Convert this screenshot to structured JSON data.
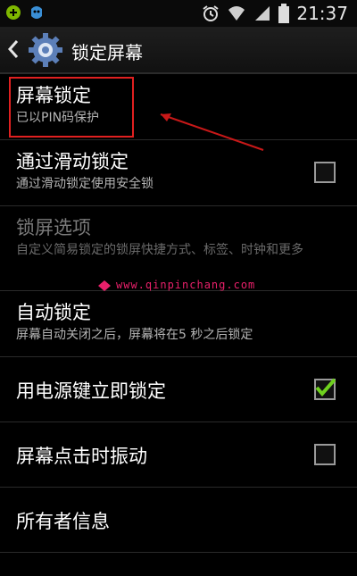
{
  "status_bar": {
    "time": "21:37",
    "icons": [
      "notification-icon",
      "usb-icon",
      "alarm-icon",
      "wifi-icon",
      "signal-icon",
      "battery-icon"
    ]
  },
  "action_bar": {
    "title": "锁定屏幕"
  },
  "settings": [
    {
      "title": "屏幕锁定",
      "subtitle": "已以PIN码保护",
      "enabled": true
    },
    {
      "title": "通过滑动锁定",
      "subtitle": "通过滑动锁定使用安全锁",
      "checked": false,
      "enabled": true
    },
    {
      "title": "锁屏选项",
      "subtitle": "自定义简易锁定的锁屏快捷方式、标签、时钟和更多",
      "enabled": false
    },
    {
      "title": "自动锁定",
      "subtitle": "屏幕自动关闭之后，屏幕将在5 秒之后锁定",
      "enabled": true
    },
    {
      "title": "用电源键立即锁定",
      "checked": true,
      "enabled": true
    },
    {
      "title": "屏幕点击时振动",
      "checked": false,
      "enabled": true
    },
    {
      "title": "所有者信息",
      "enabled": true
    }
  ],
  "watermark": "www.qinpinchang.com",
  "colors": {
    "highlight": "#e02020",
    "checkmark": "#6fd11e",
    "watermark": "#e8206a"
  }
}
